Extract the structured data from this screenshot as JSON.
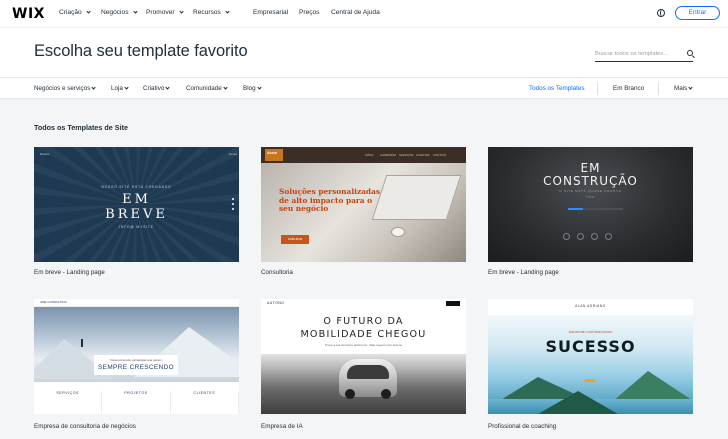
{
  "topnav": {
    "logo": "WIX",
    "items": [
      "Criação",
      "Negócios",
      "Promover",
      "Recursos"
    ],
    "links": [
      "Empresarial",
      "Preços",
      "Central de Ajuda"
    ],
    "login_label": "Entrar",
    "globe_icon": "globe-icon"
  },
  "hero": {
    "title": "Escolha seu template favorito",
    "search_placeholder": "Buscar todos os templates...",
    "search_icon": "search-icon"
  },
  "subnav": {
    "categories": [
      "Negócios e serviços",
      "Loja",
      "Criativo",
      "Comunidade",
      "Blog"
    ],
    "all_templates": "Todos os Templates",
    "blank": "Em Branco",
    "more": "Mais",
    "active_color": "#116dff"
  },
  "gallery": {
    "section_title": "Todos os Templates de Site",
    "templates": [
      {
        "caption": "Em breve - Landing page",
        "header_left": "Restnc",
        "header_right": "Home",
        "kicker": "NOSSO SITE ESTÁ CHEGANDO",
        "line1": "EM",
        "line2": "BREVE",
        "footer": "INFO@ MYSITE"
      },
      {
        "caption": "Consultoria",
        "logo": "Acorn",
        "menu": [
          "INÍCIO",
          "A EMPRESA",
          "SERVIÇOS",
          "CLIENTES",
          "CONTATO"
        ],
        "headline": [
          "Soluções personalizadas",
          "de alto impacto para o",
          "seu negócio"
        ],
        "cta": "SAIBA MAIS"
      },
      {
        "caption": "Em breve - Landing page",
        "line1": "EM",
        "line2": "CONSTRUÇÃO",
        "tagline": "O SITE ESTÁ QUASE PRONTO",
        "progress": "75%"
      },
      {
        "caption": "Empresa de consultoria de negócios",
        "brand": "AME CONSULTING",
        "box_small": "Desenvolvendo estratégias que geram",
        "box_title": "SEMPRE CRESCENDO",
        "columns": [
          "SERVIÇOS",
          "PROJETOS",
          "CLIENTES"
        ]
      },
      {
        "caption": "Empresa de IA",
        "brand": "AUTONO",
        "line1": "O FUTURO DA",
        "line2": "MOBILIDADE CHEGOU",
        "sub": "Prove a era do futuro autônomo. Viaje seguro com Autono"
      },
      {
        "caption": "Profissional de coaching",
        "brand": "ALAN ADRIANO",
        "kicker": "ENCONTRE O PRÓXIMO PASSO",
        "headline": "SUCESSO"
      }
    ]
  }
}
